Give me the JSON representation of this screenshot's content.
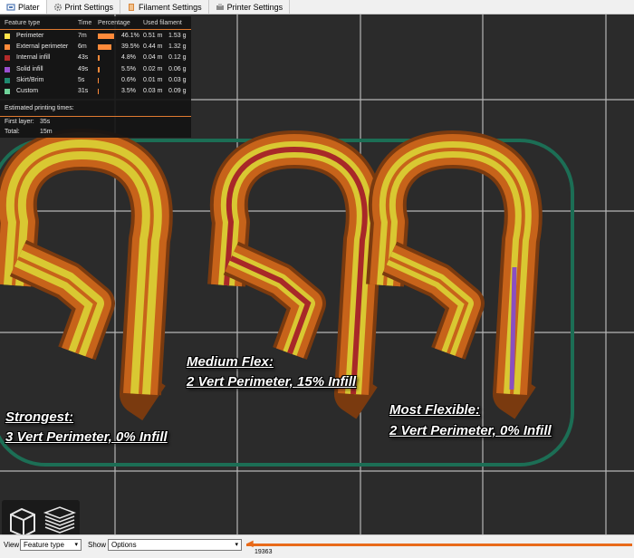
{
  "tabs": [
    {
      "label": "Plater",
      "icon": "plater-icon",
      "active": true
    },
    {
      "label": "Print Settings",
      "icon": "gear-icon",
      "active": false
    },
    {
      "label": "Filament Settings",
      "icon": "filament-icon",
      "active": false
    },
    {
      "label": "Printer Settings",
      "icon": "printer-icon",
      "active": false
    }
  ],
  "legend": {
    "headers": {
      "feature_type": "Feature type",
      "time": "Time",
      "percentage": "Percentage",
      "used_filament": "Used filament"
    },
    "rows": [
      {
        "name": "Perimeter",
        "time": "7m",
        "percent": "46.1%",
        "fraction": 0.461,
        "length": "0.51 m",
        "weight": "1.53 g",
        "color": "#ffe34a"
      },
      {
        "name": "External perimeter",
        "time": "6m",
        "percent": "39.5%",
        "fraction": 0.395,
        "length": "0.44 m",
        "weight": "1.32 g",
        "color": "#ff8a3a"
      },
      {
        "name": "Internal infill",
        "time": "43s",
        "percent": "4.8%",
        "fraction": 0.048,
        "length": "0.04 m",
        "weight": "0.12 g",
        "color": "#b22a2a"
      },
      {
        "name": "Solid infill",
        "time": "49s",
        "percent": "5.5%",
        "fraction": 0.055,
        "length": "0.02 m",
        "weight": "0.06 g",
        "color": "#9a4fd0"
      },
      {
        "name": "Skirt/Brim",
        "time": "5s",
        "percent": "0.6%",
        "fraction": 0.006,
        "length": "0.01 m",
        "weight": "0.03 g",
        "color": "#1f8a70"
      },
      {
        "name": "Custom",
        "time": "31s",
        "percent": "3.5%",
        "fraction": 0.035,
        "length": "0.03 m",
        "weight": "0.09 g",
        "color": "#6fd39a"
      }
    ],
    "estimated_label": "Estimated printing times:",
    "first_layer_label": "First layer:",
    "first_layer_value": "35s",
    "total_label": "Total:",
    "total_value": "15m"
  },
  "annotations": {
    "strongest_title": "Strongest:",
    "strongest_desc": "3 Vert Perimeter, 0% Infill",
    "medium_title": "Medium Flex:",
    "medium_desc": "2 Vert Perimeter, 15% Infill",
    "flexible_title": "Most Flexible:",
    "flexible_desc": "2 Vert Perimeter, 0% Infill"
  },
  "bottom": {
    "view_label": "View",
    "view_value": "Feature type",
    "show_label": "Show",
    "show_value": "Options",
    "slider_value": "19363"
  },
  "colors": {
    "orange": "#c7631a",
    "yellow": "#d9c832",
    "skirt": "#1c6e55",
    "grid": "#cfcfcf"
  }
}
